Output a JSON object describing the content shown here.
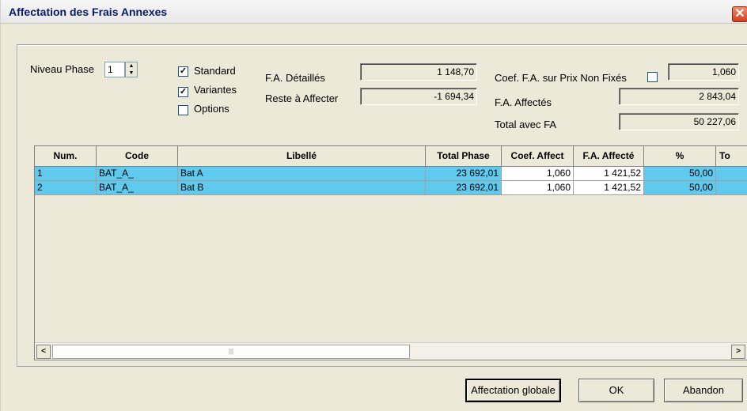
{
  "window": {
    "title": "Affectation des Frais Annexes",
    "close_glyph": "✕"
  },
  "niveau_phase": {
    "label": "Niveau Phase",
    "value": "1"
  },
  "checkboxes": {
    "standard": {
      "label": "Standard",
      "checked": true
    },
    "variantes": {
      "label": "Variantes",
      "checked": true
    },
    "options": {
      "label": "Options",
      "checked": false
    }
  },
  "fields": {
    "fa_detailles": {
      "label": "F.A. Détaillés",
      "value": "1 148,70"
    },
    "reste": {
      "label": "Reste à Affecter",
      "value": "-1 694,34"
    },
    "coef_fa": {
      "label": "Coef. F.A. sur Prix Non Fixés",
      "value": "1,060"
    },
    "fa_affectes": {
      "label": "F.A. Affectés",
      "value": "2 843,04"
    },
    "total_fa": {
      "label": "Total avec FA",
      "value": "50 227,06"
    }
  },
  "grid": {
    "columns": [
      "Num.",
      "Code",
      "Libellé",
      "Total Phase",
      "Coef. Affect",
      "F.A. Affecté",
      "%",
      "To"
    ],
    "rows": [
      [
        "1",
        "BAT_A_",
        "Bat A",
        "23 692,01",
        "1,060",
        "1 421,52",
        "50,00"
      ],
      [
        "2",
        "BAT_A_",
        "Bat B",
        "23 692,01",
        "1,060",
        "1 421,52",
        "50,00"
      ]
    ],
    "row_color": "#5fc9ee"
  },
  "scroll": {
    "left_glyph": "<",
    "right_glyph": ">",
    "grip": "|||"
  },
  "buttons": {
    "affectation_globale": "Affectation globale",
    "ok": "OK",
    "abandon": "Abandon"
  },
  "icons": {
    "checkmark": "check-icon",
    "spin": "spin-arrows-icon"
  }
}
